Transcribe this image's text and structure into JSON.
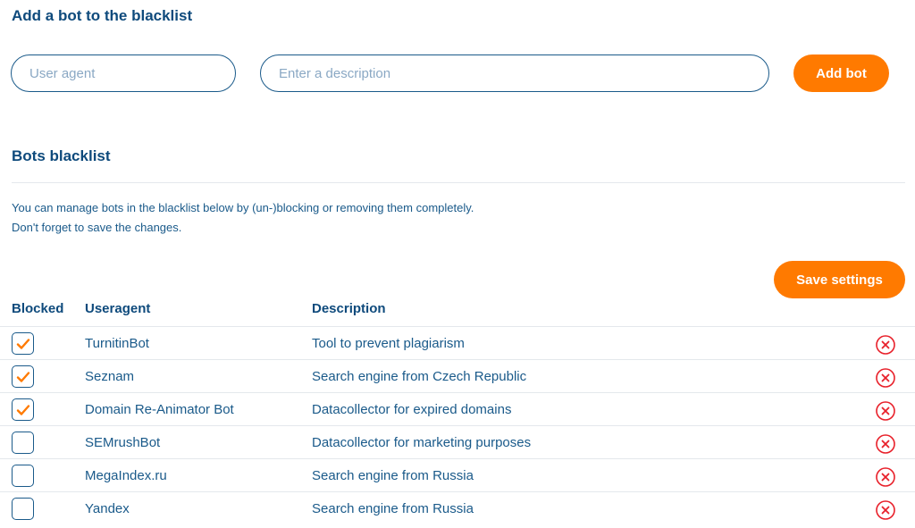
{
  "add_section": {
    "title": "Add a bot to the blacklist",
    "user_agent_placeholder": "User agent",
    "description_placeholder": "Enter a description",
    "add_button": "Add bot"
  },
  "list_section": {
    "title": "Bots blacklist",
    "info_line1": "You can manage bots in the blacklist below by (un-)blocking or removing them completely.",
    "info_line2": "Don't forget to save the changes.",
    "save_button": "Save settings",
    "columns": {
      "blocked": "Blocked",
      "useragent": "Useragent",
      "description": "Description"
    },
    "rows": [
      {
        "blocked": true,
        "useragent": "TurnitinBot",
        "description": "Tool to prevent plagiarism"
      },
      {
        "blocked": true,
        "useragent": "Seznam",
        "description": "Search engine from Czech Republic"
      },
      {
        "blocked": true,
        "useragent": "Domain Re-Animator Bot",
        "description": "Datacollector for expired domains"
      },
      {
        "blocked": false,
        "useragent": "SEMrushBot",
        "description": "Datacollector for marketing purposes"
      },
      {
        "blocked": false,
        "useragent": "MegaIndex.ru",
        "description": "Search engine from Russia"
      },
      {
        "blocked": false,
        "useragent": "Yandex",
        "description": "Search engine from Russia"
      }
    ]
  },
  "icons": {
    "checkmark": "checkmark-icon",
    "remove": "remove-circle-x-icon"
  },
  "colors": {
    "accent": "#ff7a00",
    "primary": "#0e4a7c",
    "text": "#1a5a8a",
    "danger": "#e8202a"
  }
}
